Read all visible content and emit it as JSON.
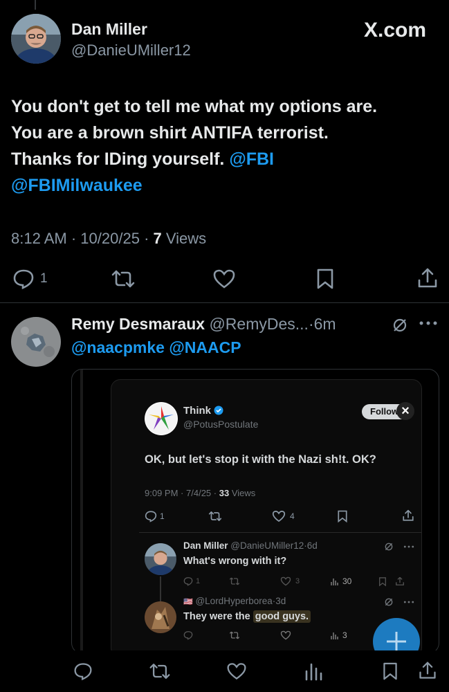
{
  "main_post": {
    "author_name": "Dan Miller",
    "author_handle": "@DanieUMiller12",
    "source_label": "X.com",
    "text_line1": "You don't get to tell me what my options are.",
    "text_line2": "You are a brown shirt ANTIFA terrorist.",
    "text_line3_plain": "Thanks for IDing yourself.",
    "mention_fbi": "@FBI",
    "mention_fbimilwaukee": "@FBIMilwaukee",
    "time": "8:12 AM",
    "date": "10/20/25",
    "views_count": "7",
    "views_label": "Views",
    "reply_count": "1",
    "meta_sep": "·"
  },
  "reply": {
    "author_name": "Remy Desmaraux",
    "author_handle": "@RemyDes...",
    "age": "6m",
    "sep": "·",
    "mention1": "@naacpmke",
    "mention2": "@NAACP"
  },
  "embedded": {
    "quoted": {
      "author_name": "Think",
      "author_handle": "@PotusPostulate",
      "follow_label": "Follow",
      "close_glyph": "×",
      "text": "OK, but let's stop it with the Nazi sh!t. OK?",
      "time": "9:09 PM",
      "date": "7/4/25",
      "views_count": "33",
      "views_label": "Views",
      "reply_count": "1",
      "like_count": "4",
      "sep": "·"
    },
    "reply1": {
      "author_name": "Dan Miller",
      "author_handle": "@DanieUMiller12",
      "age": "6d",
      "text": "What's wrong with it?",
      "reply_count": "1",
      "like_count": "3",
      "views_count": "30",
      "sep": "·"
    },
    "reply2": {
      "flag": "🇺🇸",
      "author_handle": "@LordHyperborea",
      "age": "3d",
      "text_plain": "They were the",
      "text_highlight": "good guys.",
      "views_count": "3",
      "sep": "·"
    }
  },
  "colors": {
    "background": "#000000",
    "text": "#e7e9ea",
    "muted": "#8b98a5",
    "link": "#1d9bf0",
    "divider": "#2f3336",
    "highlight": "#3a3320"
  }
}
